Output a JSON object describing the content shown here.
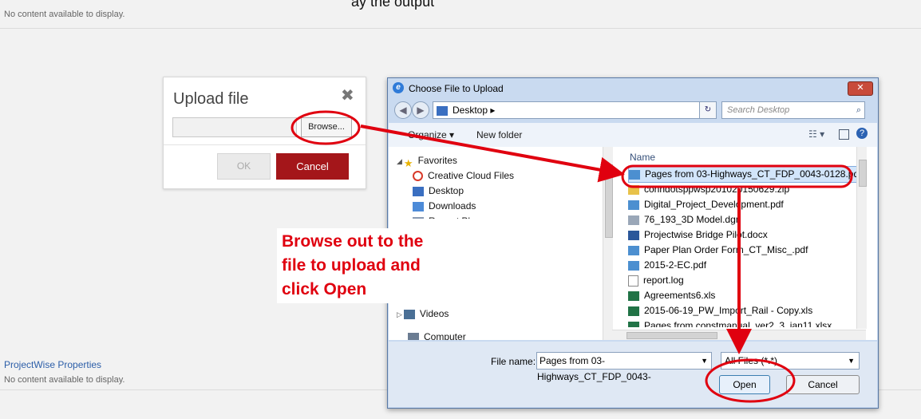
{
  "background": {
    "top_caption": "ay  the output",
    "top_empty": "No content available to display.",
    "section_title": "ProjectWise Properties",
    "bottom_empty": "No content available to display."
  },
  "upload_dialog": {
    "title": "Upload file",
    "close_icon": "close-x-icon",
    "browse_label": "Browse...",
    "ok_label": "OK",
    "cancel_label": "Cancel"
  },
  "chooser": {
    "title": "Choose File to Upload",
    "close_label": "✕",
    "address": "Desktop ▸",
    "search_placeholder": "Search Desktop",
    "toolbar": {
      "organize": "Organize ▾",
      "new_folder": "New folder"
    },
    "nav": [
      {
        "label": "Favorites",
        "icon": "star-icon"
      },
      {
        "label": "Creative Cloud Files",
        "icon": "creative-cloud-icon"
      },
      {
        "label": "Desktop",
        "icon": "desktop-icon"
      },
      {
        "label": "Downloads",
        "icon": "downloads-icon"
      },
      {
        "label": "Recent Places",
        "icon": "recent-icon"
      },
      {
        "label": "Videos",
        "icon": "videos-icon"
      }
    ],
    "column_header": "Name",
    "files": [
      {
        "name": "Pages from 03-Highways_CT_FDP_0043-0128.pdf",
        "icon": "pdf-icon",
        "selected": true
      },
      {
        "name": "conndotsppwsp201020150629.zip",
        "icon": "zip-icon"
      },
      {
        "name": "Digital_Project_Development.pdf",
        "icon": "pdf-icon"
      },
      {
        "name": "76_193_3D Model.dgn",
        "icon": "dgn-icon"
      },
      {
        "name": "Projectwise Bridge Pilot.docx",
        "icon": "word-icon"
      },
      {
        "name": "Paper Plan Order Form_CT_Misc_.pdf",
        "icon": "pdf-icon"
      },
      {
        "name": "2015-2-EC.pdf",
        "icon": "pdf-icon"
      },
      {
        "name": "report.log",
        "icon": "text-file-icon"
      },
      {
        "name": "Agreements6.xls",
        "icon": "excel-icon"
      },
      {
        "name": "2015-06-19_PW_Import_Rail - Copy.xls",
        "icon": "excel-icon"
      },
      {
        "name": "Pages from constmanual_ver2_3_jan11.xlsx",
        "icon": "excel-icon"
      }
    ],
    "file_name_label": "File name:",
    "file_name_value": "Pages from 03-Highways_CT_FDP_0043-",
    "file_type_value": "All Files (*.*)",
    "open_label": "Open",
    "cancel_label": "Cancel"
  },
  "annotation": {
    "lines": [
      "Browse out to the",
      "file to upload and",
      "click Open"
    ],
    "color": "#e0000f"
  }
}
